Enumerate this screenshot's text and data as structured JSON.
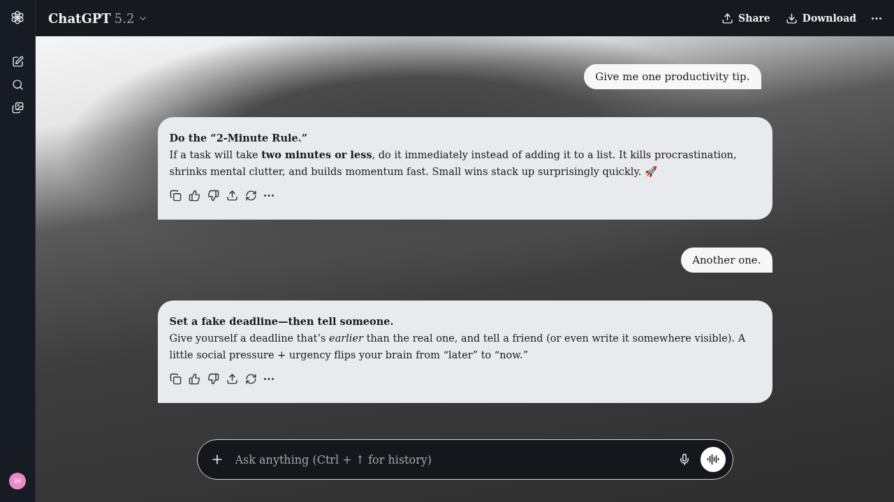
{
  "header": {
    "title": "ChatGPT",
    "version": "5.2",
    "actions": [
      {
        "kind": "share",
        "label": "Share"
      },
      {
        "kind": "download",
        "label": "Download"
      }
    ]
  },
  "sidebar": {
    "avatar_initials": "IH"
  },
  "messages": [
    {
      "kind": "user",
      "text": "Give me one productivity tip."
    },
    {
      "kind": "assistant",
      "heading": "Do the “2-Minute Rule.”",
      "body": "If a task will take **two minutes or less**, do it immediately instead of adding it to a list. It kills procrastination, shrinks mental clutter, and builds momentum fast. Small wins stack up surprisingly quickly. 🚀"
    },
    {
      "kind": "user",
      "text": "Another one."
    },
    {
      "kind": "assistant",
      "heading": "Set a fake deadline—then tell someone.",
      "body": "Give yourself a deadline that’s *earlier* than the real one, and tell a friend (or even write it somewhere visible). A little social pressure + urgency flips your brain from “later” to “now.”"
    }
  ],
  "composer": {
    "placeholder": "Ask anything (Ctrl + ↑ for history)"
  }
}
